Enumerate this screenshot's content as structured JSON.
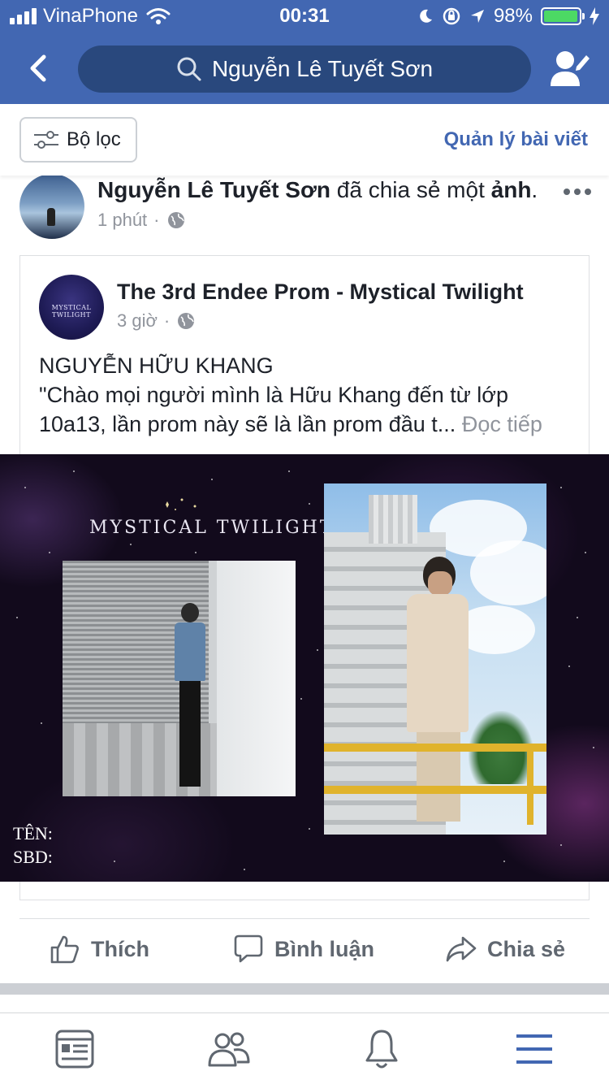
{
  "status_bar": {
    "carrier": "VinaPhone",
    "time": "00:31",
    "battery": "98%",
    "battery_level": 0.98,
    "colors": {
      "bar": "#4267b2",
      "battery_fill": "#4cd964"
    }
  },
  "nav": {
    "search_text": "Nguyễn Lê Tuyết Sơn",
    "icons": [
      "back-arrow-icon",
      "search-icon",
      "profile-edit-icon"
    ]
  },
  "filter": {
    "label": "Bộ lọc",
    "manage_label": "Quản lý bài viết",
    "accent": "#4267b2"
  },
  "post": {
    "author": "Nguyễn Lê Tuyết Sơn",
    "action_text": " đã chia sẻ một ",
    "object_text": "ảnh",
    "time": "1 phút",
    "shared": {
      "page_name": "The 3rd Endee Prom - Mystical Twilight",
      "page_avatar_text": "MYSTICAL TWILIGHT",
      "time": "3 giờ",
      "text_line1": "NGUYỄN HỮU KHANG",
      "text_line2": "\"Chào mọi người mình là Hữu Khang đến từ lớp",
      "text_line3": "10a13, lần prom này sẽ là lần prom đầu t...",
      "read_more": " Đọc tiếp",
      "image": {
        "title": "MYSTICAL TWILIGHT",
        "label_name": "TÊN:",
        "label_id": "SBD:"
      }
    }
  },
  "actions": {
    "like": "Thích",
    "comment": "Bình luận",
    "share": "Chia sẻ"
  },
  "tabbar": {
    "icons": [
      "news-feed-icon",
      "friends-icon",
      "notifications-icon",
      "menu-icon"
    ],
    "active_color": "#4267b2"
  }
}
